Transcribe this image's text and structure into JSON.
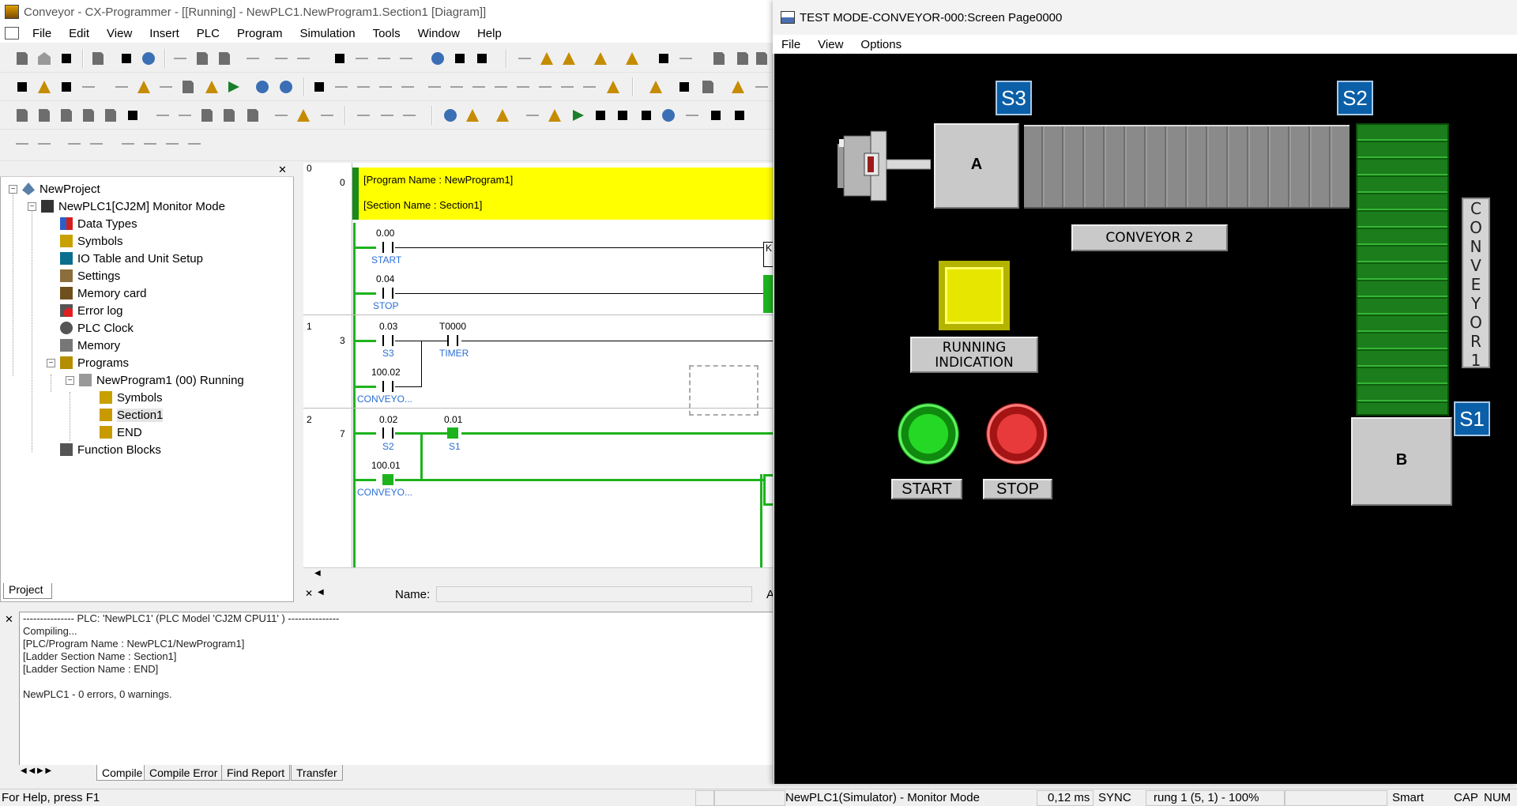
{
  "main_window": {
    "title": "Conveyor - CX-Programmer - [[Running] - NewPLC1.NewProgram1.Section1 [Diagram]]",
    "menu": [
      "File",
      "Edit",
      "View",
      "Insert",
      "PLC",
      "Program",
      "Simulation",
      "Tools",
      "Window",
      "Help"
    ]
  },
  "project_tree": {
    "items": [
      {
        "label": "NewProject"
      },
      {
        "label": "NewPLC1[CJ2M] Monitor Mode"
      },
      {
        "label": "Data Types"
      },
      {
        "label": "Symbols"
      },
      {
        "label": "IO Table and Unit Setup"
      },
      {
        "label": "Settings"
      },
      {
        "label": "Memory card"
      },
      {
        "label": "Error log"
      },
      {
        "label": "PLC Clock"
      },
      {
        "label": "Memory"
      },
      {
        "label": "Programs"
      },
      {
        "label": "NewProgram1 (00) Running"
      },
      {
        "label": "Symbols"
      },
      {
        "label": "Section1"
      },
      {
        "label": "END"
      },
      {
        "label": "Function Blocks"
      }
    ],
    "tab": "Project"
  },
  "ladder": {
    "comment": {
      "program": "[Program Name : NewProgram1]",
      "section": "[Section Name : Section1]"
    },
    "rungs": [
      {
        "rung": "0",
        "step": "0"
      },
      {
        "rung": "1",
        "step": "3"
      },
      {
        "rung": "2",
        "step": "7"
      }
    ],
    "contacts": [
      {
        "addr": "0.00",
        "symbol": "START"
      },
      {
        "addr": "0.04",
        "symbol": "STOP"
      },
      {
        "addr": "0.03",
        "symbol": "S3"
      },
      {
        "addr": "T0000",
        "symbol": "TIMER"
      },
      {
        "addr": "100.02",
        "symbol": "CONVEYO..."
      },
      {
        "addr": "0.02",
        "symbol": "S2"
      },
      {
        "addr": "0.01",
        "symbol": "S1"
      },
      {
        "addr": "100.01",
        "symbol": "CONVEYO..."
      }
    ],
    "coil_label_fragment": "K",
    "name_label": "Name:",
    "right_fragment": "A"
  },
  "output": {
    "lines": [
      "--------------- PLC: 'NewPLC1' (PLC Model 'CJ2M CPU11' ) ---------------",
      "Compiling...",
      "[PLC/Program Name : NewPLC1/NewProgram1]",
      "[Ladder Section Name : Section1]",
      "[Ladder Section Name : END]",
      "",
      "NewPLC1 - 0 errors, 0 warnings."
    ],
    "tabs": [
      "Compile",
      "Compile Error",
      "Find Report",
      "Transfer"
    ]
  },
  "status_bar": {
    "help": "For Help, press F1",
    "mode": "NewPLC1(Simulator) - Monitor Mode",
    "time": "0,12 ms",
    "sync": "SYNC",
    "position": "rung 1 (5, 1)  - 100%",
    "smart": "Smart",
    "cap": "CAP",
    "num": "NUM"
  },
  "sim_window": {
    "title": "TEST MODE-CONVEYOR-000:Screen Page0000",
    "menu": [
      "File",
      "View",
      "Options"
    ],
    "sensors": {
      "s3": "S3",
      "s2": "S2",
      "s1": "S1"
    },
    "box_a": "A",
    "box_b": "B",
    "conveyor2_label": "CONVEYOR 2",
    "conveyor1_letters": [
      "C",
      "O",
      "N",
      "V",
      "E",
      "Y",
      "O",
      "R",
      "1"
    ],
    "running_label_1": "RUNNING",
    "running_label_2": "INDICATION",
    "start_label": "START",
    "stop_label": "STOP",
    "colors": {
      "conveyor1": "#1b7d1b",
      "lamp": "#e6e600",
      "sensor": "#0a5fa8",
      "start": "#25d825",
      "stop": "#e83a3a"
    }
  }
}
